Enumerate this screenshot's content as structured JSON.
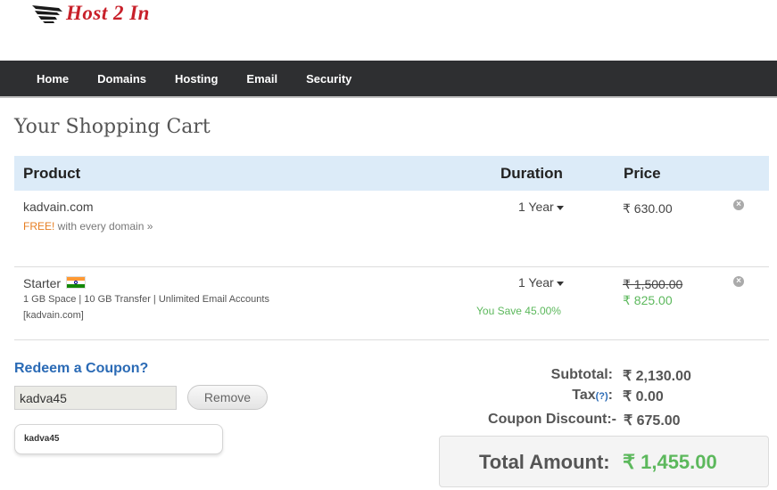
{
  "brand": {
    "logo_text_host": "Host",
    "logo_text_2": "2",
    "logo_text_in": "In"
  },
  "nav": {
    "items": [
      "Home",
      "Domains",
      "Hosting",
      "Email",
      "Security"
    ]
  },
  "page": {
    "title": "Your Shopping Cart"
  },
  "cart": {
    "headers": {
      "product": "Product",
      "duration": "Duration",
      "price": "Price"
    },
    "items": [
      {
        "name": "kadvain.com",
        "free_word": "FREE!",
        "free_text": " with every domain",
        "free_link": "»",
        "duration": "1 Year",
        "price": "₹ 630.00"
      },
      {
        "name": "Starter",
        "specs": "1 GB Space | 10 GB Transfer | Unlimited Email Accounts",
        "domain": "[kadvain.com]",
        "duration": "1 Year",
        "savings": "You Save 45.00%",
        "old_price": "₹ 1,500.00",
        "new_price": "₹ 825.00"
      }
    ]
  },
  "coupon": {
    "title": "Redeem a Coupon?",
    "value": "kadva45",
    "remove_label": "Remove",
    "suggestion": "kadva45"
  },
  "totals": {
    "subtotal_label": "Subtotal:",
    "subtotal_value": "₹ 2,130.00",
    "tax_label": "Tax",
    "tax_link": "(?)",
    "tax_colon": ":",
    "tax_value": "₹ 0.00",
    "discount_label": "Coupon Discount:-",
    "discount_value": "₹ 675.00",
    "total_label": "Total Amount:",
    "total_value": "₹ 1,455.00"
  },
  "colors": {
    "navbar": "#2e2f31",
    "header_bg": "#dcebf8",
    "accent_green": "#5cb85c",
    "link_blue": "#2a6ab5",
    "logo_red": "#c8202a"
  }
}
